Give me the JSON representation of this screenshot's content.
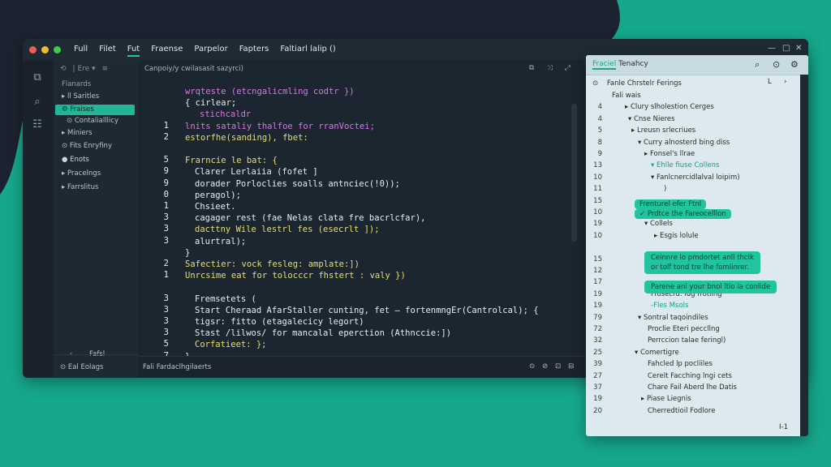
{
  "colors": {
    "accent": "#1fb795",
    "background": "#16a88c",
    "editor_bg": "#1c2630",
    "panel_bg": "#dde9ee"
  },
  "window": {
    "menu": [
      "Full",
      "Filet",
      "Fut",
      "Fraense",
      "Parpelor",
      "Fapters",
      "Faltiarl lalip ()"
    ],
    "controls": [
      "—",
      "□",
      "✕"
    ]
  },
  "sidebar": {
    "toolbar": [
      "⟲",
      "| Ere ▾",
      "≡"
    ],
    "heading": "Flanards",
    "items": [
      {
        "label": "▸ ll  Saritles",
        "selected": false
      },
      {
        "label": "⚙  Fraises",
        "selected": true
      },
      {
        "label": "⊙  Contalialllicy",
        "selected": false
      },
      {
        "label": "▸ Miniers",
        "selected": false
      },
      {
        "label": "⊙  Fits Enryfiny",
        "selected": false
      },
      {
        "label": "● Enots",
        "selected": false
      },
      {
        "label": "▸ Pracelngs",
        "selected": false
      },
      {
        "label": "▸ Farrslitus",
        "selected": false
      }
    ],
    "footer_label": "Fafsl",
    "bottom": "⊙ Eal Eolags"
  },
  "editor": {
    "header_text": "Canpoiy/y cwilasasit sazyrci)",
    "header_icons": [
      "⧉",
      "⤨",
      "⤢"
    ],
    "lines": [
      {
        "n": "",
        "x": 0,
        "t": "wrqteste (etcngalicmling codtr })",
        "c": "#d678e0"
      },
      {
        "n": "",
        "x": 0,
        "t": "{  cirlear;",
        "c": "#e7edf0"
      },
      {
        "n": "",
        "x": 18,
        "t": "stichcaldr",
        "c": "#d678e0"
      },
      {
        "n": "1",
        "x": 0,
        "t": "lnits sataliy thalfoe for rranVoctei;",
        "c": "#d678e0"
      },
      {
        "n": "2",
        "x": 0,
        "t": "estorfhe(sanding), fbet:",
        "c": "#e8de6c"
      },
      {
        "n": "",
        "x": 0,
        "t": "",
        "c": "#e7edf0"
      },
      {
        "n": "5",
        "x": 0,
        "t": "Frarncie le bat: {",
        "c": "#e8de6c"
      },
      {
        "n": "9",
        "x": 12,
        "t": "Clarer Lerlaiia (fofet ]",
        "c": "#e7edf0"
      },
      {
        "n": "9",
        "x": 12,
        "t": "dorader Porloclies soalls antnciec(!0));",
        "c": "#e7edf0"
      },
      {
        "n": "0",
        "x": 12,
        "t": "peragol);",
        "c": "#e7edf0"
      },
      {
        "n": "1",
        "x": 12,
        "t": "Chsieet.",
        "c": "#e7edf0"
      },
      {
        "n": "3",
        "x": 12,
        "t": "cagager rest (fae Nelas clata fre bacrlcfar),",
        "c": "#e7edf0"
      },
      {
        "n": "3",
        "x": 12,
        "t": "dacttny Wile lestrl fes (esecrlt ]);",
        "c": "#e8de6c"
      },
      {
        "n": "3",
        "x": 12,
        "t": "alurtral);",
        "c": "#e7edf0"
      },
      {
        "n": "",
        "x": 0,
        "t": "}",
        "c": "#e7edf0"
      },
      {
        "n": "2",
        "x": 0,
        "t": "Safectier: vock fesleg: amplate:])",
        "c": "#e8de6c"
      },
      {
        "n": "1",
        "x": 0,
        "t": "Unrcsime eat for tolocccr fhstert : valy })",
        "c": "#e8de6c"
      },
      {
        "n": "",
        "x": 0,
        "t": "",
        "c": "#e7edf0"
      },
      {
        "n": "3",
        "x": 12,
        "t": "Fremsetets (",
        "c": "#e7edf0"
      },
      {
        "n": "3",
        "x": 12,
        "t": "Start Cheraad AfarStaller cunting, fet — fortenmngEr(Cantrolcal); {",
        "c": "#e7edf0"
      },
      {
        "n": "3",
        "x": 12,
        "t": "tigsr: fitto (etagalecicy legort)",
        "c": "#e7edf0"
      },
      {
        "n": "3",
        "x": 12,
        "t": "Stast /lilwos/ for mancalal eperction (Athnccie:])",
        "c": "#e7edf0"
      },
      {
        "n": "5",
        "x": 12,
        "t": "Corfatieet:  };",
        "c": "#e8de6c"
      },
      {
        "n": "7",
        "x": 0,
        "t": "}",
        "c": "#e7edf0"
      },
      {
        "n": "",
        "x": -8,
        "t": "}",
        "c": "#e7edf0"
      }
    ]
  },
  "status": {
    "left": "Fali Fardaclhgilaerts",
    "icons": [
      "⊙",
      "⊘",
      "⊡",
      "⊟"
    ]
  },
  "panel": {
    "tab_accent": "Fraciel",
    "tab_title": "Tenahcy",
    "icons": [
      "⌕",
      "⊙",
      "⚙"
    ],
    "row0": {
      "icon": "⊙",
      "text": "Fanle Chrstelr Ferings",
      "right_icons": [
        "L",
        "›"
      ]
    },
    "rows": [
      {
        "n": "",
        "x": 0,
        "t": "Fali wais"
      },
      {
        "n": "4",
        "x": 16,
        "t": "▸ Clury slholestion Cerges"
      },
      {
        "n": "4",
        "x": 20,
        "t": "▾ Cnse Nieres"
      },
      {
        "n": "5",
        "x": 24,
        "t": "▸ Lreusn srlecriues"
      },
      {
        "n": "8",
        "x": 32,
        "t": "▾ Curry alnosterd bing diss"
      },
      {
        "n": "9",
        "x": 40,
        "t": "▸ Fonsel's llrae"
      },
      {
        "n": "13",
        "x": 48,
        "t": "▾ Ehlle fiuse Collens",
        "accent": true
      },
      {
        "n": "10",
        "x": 48,
        "t": "▾ Fanlcnercidlalval loipim)"
      },
      {
        "n": "11",
        "x": 64,
        "t": ")"
      },
      {
        "n": "15",
        "x": 0,
        "t": ""
      },
      {
        "n": "10",
        "x": 0,
        "t": ""
      },
      {
        "n": "19",
        "x": 40,
        "t": "▾ Collels"
      },
      {
        "n": "10",
        "x": 52,
        "t": "▸ Esgis lolule"
      },
      {
        "n": "",
        "x": 0,
        "t": ""
      },
      {
        "n": "15",
        "x": 0,
        "t": ""
      },
      {
        "n": "12",
        "x": 0,
        "t": ""
      },
      {
        "n": "17",
        "x": 0,
        "t": ""
      },
      {
        "n": "19",
        "x": 48,
        "t": "Frosecrd: lug frotling",
        "accent2": true
      },
      {
        "n": "19",
        "x": 48,
        "t": "-Fles Msols",
        "accent": true
      },
      {
        "n": "79",
        "x": 32,
        "t": "▾ Sontral taqoindiles"
      },
      {
        "n": "72",
        "x": 44,
        "t": "Proclie Eteri peccllng"
      },
      {
        "n": "32",
        "x": 44,
        "t": "Perrccion talae feringl)"
      },
      {
        "n": "25",
        "x": 28,
        "t": "▾ Comertigre"
      },
      {
        "n": "39",
        "x": 44,
        "t": "Fahcled lp pocliiles"
      },
      {
        "n": "27",
        "x": 44,
        "t": "Cerelt Facching lngi cets"
      },
      {
        "n": "37",
        "x": 44,
        "t": "Chare Fail Aberd lhe Datis"
      },
      {
        "n": "19",
        "x": 36,
        "t": "▸ Piase Liegnis"
      },
      {
        "n": "20",
        "x": 44,
        "t": "Cherredtioil Fodlore"
      }
    ],
    "badges": [
      "Frenturel efer Ftnl",
      "✓ Prdtce the Fareocelllon",
      "Ceinnre lo pmdortet anll thcik\nor tolf tond tre lhe fomlinrer.",
      "Parene anl your bnol ltio la conlide"
    ],
    "row_last_right": "I-1"
  }
}
